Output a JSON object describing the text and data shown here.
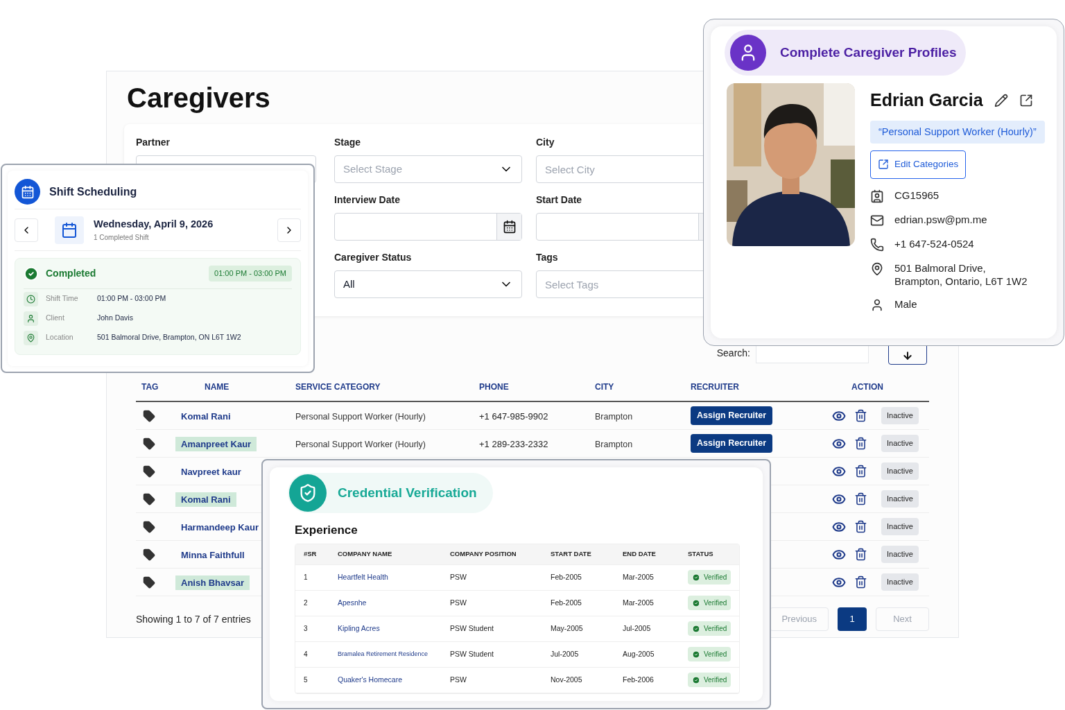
{
  "page": {
    "title": "Caregivers"
  },
  "filters": {
    "partner": {
      "label": "Partner"
    },
    "fields": [
      {
        "label": "Stage",
        "kind": "select",
        "placeholder": "Select Stage"
      },
      {
        "label": "City",
        "kind": "text",
        "placeholder": "Select City"
      },
      {
        "label": "Interview Date",
        "kind": "date"
      },
      {
        "label": "Start Date",
        "kind": "date"
      },
      {
        "label": "Caregiver Status",
        "kind": "select",
        "value": "All"
      },
      {
        "label": "Tags",
        "kind": "text",
        "placeholder": "Select Tags"
      }
    ]
  },
  "search": {
    "label": "Search:"
  },
  "table": {
    "columns": [
      "TAG",
      "NAME",
      "SERVICE CATEGORY",
      "PHONE",
      "CITY",
      "RECRUITER",
      "ACTION"
    ],
    "rows": [
      {
        "name": "Komal Rani",
        "highlighted": false,
        "service_category": "Personal Support Worker (Hourly)",
        "phone": "+1 647-985-9902",
        "city": "Brampton",
        "recruiter": "Assign Recruiter",
        "status": "Inactive"
      },
      {
        "name": "Amanpreet Kaur",
        "highlighted": true,
        "service_category": "Personal Support Worker (Hourly)",
        "phone": "+1 289-233-2332",
        "city": "Brampton",
        "recruiter": "Assign Recruiter",
        "status": "Inactive"
      },
      {
        "name": "Navpreet kaur",
        "highlighted": false,
        "status": "Inactive"
      },
      {
        "name": "Komal Rani",
        "highlighted": true,
        "status": "Inactive"
      },
      {
        "name": "Harmandeep Kaur",
        "highlighted": false,
        "status": "Inactive"
      },
      {
        "name": "Minna Faithfull",
        "highlighted": false,
        "status": "Inactive"
      },
      {
        "name": "Anish Bhavsar",
        "highlighted": true,
        "status": "Inactive"
      }
    ]
  },
  "pagination": {
    "summary": "Showing 1 to 7 of 7 entries",
    "previous": {
      "label": "Previous",
      "disabled": true
    },
    "pages": [
      {
        "label": "1",
        "selected": true
      }
    ],
    "next": {
      "label": "Next",
      "disabled": true
    }
  },
  "shift_card": {
    "title": "Shift Scheduling",
    "date": "Wednesday, April 9, 2026",
    "subtitle": "1 Completed Shift",
    "status": "Completed",
    "time_badge": "01:00 PM - 03:00 PM",
    "details": [
      {
        "kind": "time",
        "label": "Shift Time",
        "value": "01:00 PM - 03:00 PM"
      },
      {
        "kind": "client",
        "label": "Client",
        "value": "John Davis"
      },
      {
        "kind": "location",
        "label": "Location",
        "value": "501 Balmoral Drive, Brampton, ON L6T 1W2"
      }
    ]
  },
  "profile_card": {
    "title": "Complete Caregiver Profiles",
    "name": "Edrian Garcia",
    "category": "“Personal Support Worker (Hourly)”",
    "edit_button": "Edit Categories",
    "details": [
      {
        "kind": "id",
        "value": "CG15965"
      },
      {
        "kind": "email",
        "value": "edrian.psw@pm.me"
      },
      {
        "kind": "phone",
        "value": "+1 647-524-0524"
      },
      {
        "kind": "address",
        "value": "501 Balmoral Drive, Brampton, Ontario, L6T 1W2"
      },
      {
        "kind": "gender",
        "value": "Male"
      }
    ]
  },
  "credential_card": {
    "title": "Credential Verification",
    "section": "Experience",
    "columns": [
      "#SR",
      "COMPANY NAME",
      "COMPANY POSITION",
      "START DATE",
      "END DATE",
      "STATUS"
    ],
    "rows": [
      {
        "sr": "1",
        "company": "Heartfelt Health",
        "position": "PSW",
        "start": "Feb-2005",
        "end": "Mar-2005",
        "status": "Verified",
        "verified": true
      },
      {
        "sr": "2",
        "company": "Apesnhe",
        "position": "PSW",
        "start": "Feb-2005",
        "end": "Mar-2005",
        "status": "Verified",
        "verified": true
      },
      {
        "sr": "3",
        "company": "Kipling Acres",
        "position": "PSW Student",
        "start": "May-2005",
        "end": "Jul-2005",
        "status": "Verified",
        "verified": true
      },
      {
        "sr": "4",
        "company": "Bramalea Retirement Residence",
        "position": "PSW Student",
        "start": "Jul-2005",
        "end": "Aug-2005",
        "status": "Verified",
        "verified": true
      },
      {
        "sr": "5",
        "company": "Quaker's Homecare",
        "position": "PSW",
        "start": "Nov-2005",
        "end": "Feb-2006",
        "status": "Verified",
        "verified": true
      }
    ]
  }
}
